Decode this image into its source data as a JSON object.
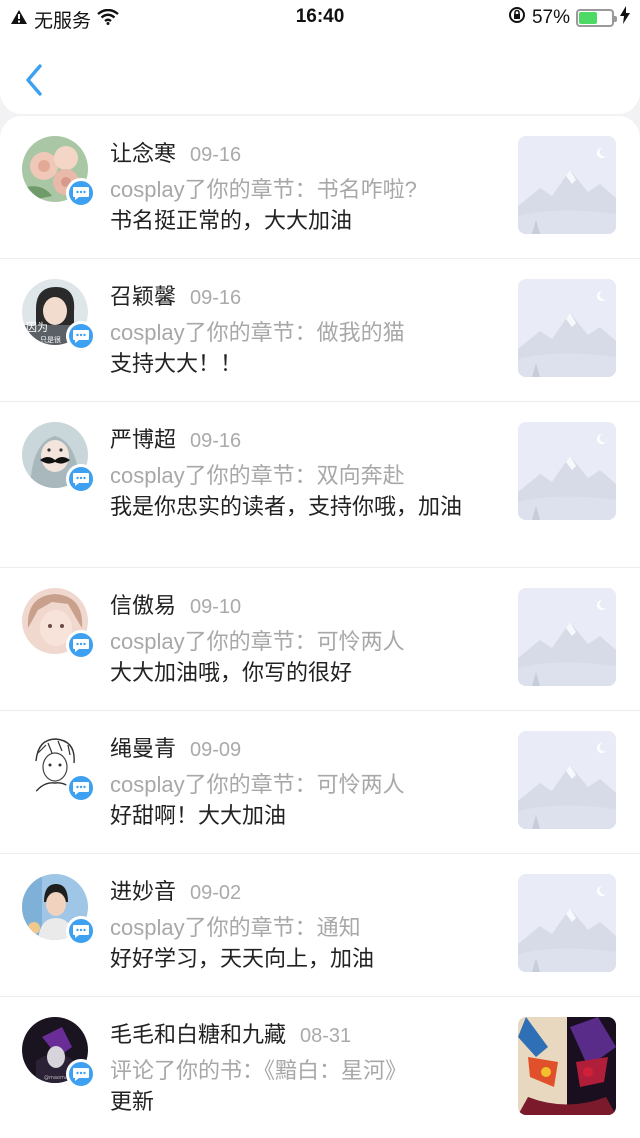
{
  "status_bar": {
    "carrier": "无服务",
    "time": "16:40",
    "battery_percent": "57%",
    "battery_level": 0.57
  },
  "nav": {
    "back_icon": "chevron-left-icon"
  },
  "colors": {
    "accent": "#3ea0f0",
    "meta": "#a8a8a8",
    "text": "#222222"
  },
  "items": [
    {
      "name": "让念寒",
      "date": "09-16",
      "action": "cosplay了你的章节：书名咋啦?",
      "comment": "书名挺正常的，大大加油",
      "avatar": "roses"
    },
    {
      "name": "召颖馨",
      "date": "09-16",
      "action": "cosplay了你的章节：做我的猫",
      "comment": "支持大大！！",
      "avatar": "girl"
    },
    {
      "name": "严博超",
      "date": "09-16",
      "action": "cosplay了你的章节：双向奔赴",
      "comment": "我是你忠实的读者，支持你哦，加油",
      "avatar": "mustache"
    },
    {
      "name": "信傲易",
      "date": "09-10",
      "action": "cosplay了你的章节：可怜两人",
      "comment": "大大加油哦，你写的很好",
      "avatar": "anime"
    },
    {
      "name": "绳曼青",
      "date": "09-09",
      "action": "cosplay了你的章节：可怜两人",
      "comment": "好甜啊！大大加油",
      "avatar": "sketch"
    },
    {
      "name": "进妙音",
      "date": "09-02",
      "action": "cosplay了你的章节：通知",
      "comment": "好好学习，天天向上，加油",
      "avatar": "boy"
    },
    {
      "name": "毛毛和白糖和九藏",
      "date": "08-31",
      "action": "评论了你的书：《黯白：星河》",
      "comment": "更新",
      "avatar": "dark"
    }
  ]
}
